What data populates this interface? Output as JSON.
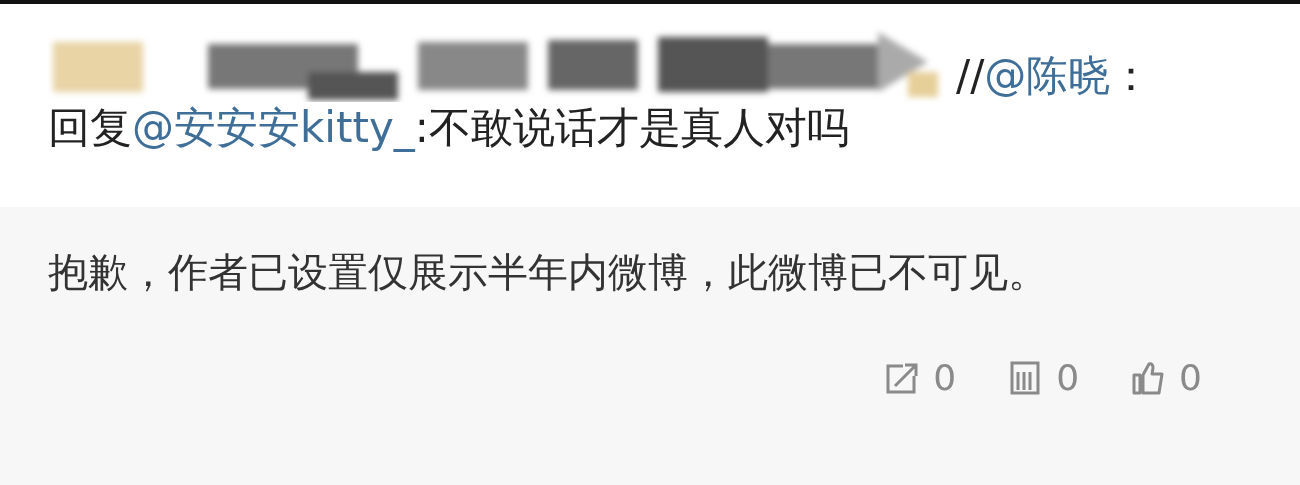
{
  "post": {
    "forward_prefix": "//",
    "forward_mention": "@陈晓",
    "forward_suffix": "：",
    "reply_prefix": "回复",
    "reply_mention": "@安安安kitty_",
    "reply_text": ":不敢说话才是真人对吗"
  },
  "retweet": {
    "notice": "抱歉，作者已设置仅展示半年内微博，此微博已不可见。"
  },
  "actions": [
    {
      "kind": "repost",
      "count": "0"
    },
    {
      "kind": "comment",
      "count": "0"
    },
    {
      "kind": "like",
      "count": "0"
    }
  ]
}
